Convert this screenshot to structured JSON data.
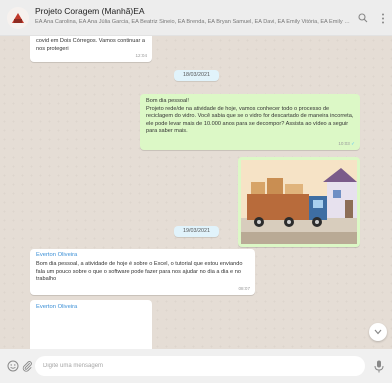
{
  "header": {
    "group_name": "Projeto Coragem (Manhã)EA",
    "members": "EA Ana Carolina, EA Ana Júlia Garcia, EA Beatriz Sineio, EA Brenda, EA Bryan Samuel, EA Davi, EA Emily Vitória, EA Emily Vitória Dos S..."
  },
  "messages": {
    "m1": {
      "text": "covid em Dois Córregos. Vamos continuar a nos protegeri",
      "time": "12:04"
    },
    "date1": "18/03/2021",
    "m2": {
      "line1": "Bom dia pessoal!",
      "line2": "Projeto rede/de na atividade de hoje, vamos conhecer todo o processo de reciclagem do vidro. Você sabia que se o vidro for descartado de maneira incorreta, ele pode levar mais de 10.000 anos para se decompor? Assista ao vídeo a seguir para saber mais.",
      "time": "10:03"
    },
    "date2": "19/03/2021",
    "m4": {
      "sender": "Everton Oliveira",
      "text": "Bom dia pessoal, a atividade de hoje é sobre o Excel, o tutorial que estou enviando fala um pouco sobre o que o software pode fazer para nos ajudar no dia a dia e no trabalho",
      "time": "08:07"
    },
    "m5": {
      "sender": "Everton Oliveira"
    }
  },
  "footer": {
    "placeholder": "Digite uma mensagem"
  },
  "icons": {
    "search": "search-icon",
    "menu": "menu-icon",
    "emoji": "emoji-icon",
    "attach": "attach-icon",
    "mic": "mic-icon",
    "scroll": "chevron-down-icon"
  },
  "colors": {
    "chat_background": "#e5ddd5",
    "outgoing_bubble": "#dcf8c6",
    "incoming_bubble": "#ffffff",
    "sender_name": "#3a8fd6",
    "date_chip": "#e1f3fb"
  }
}
